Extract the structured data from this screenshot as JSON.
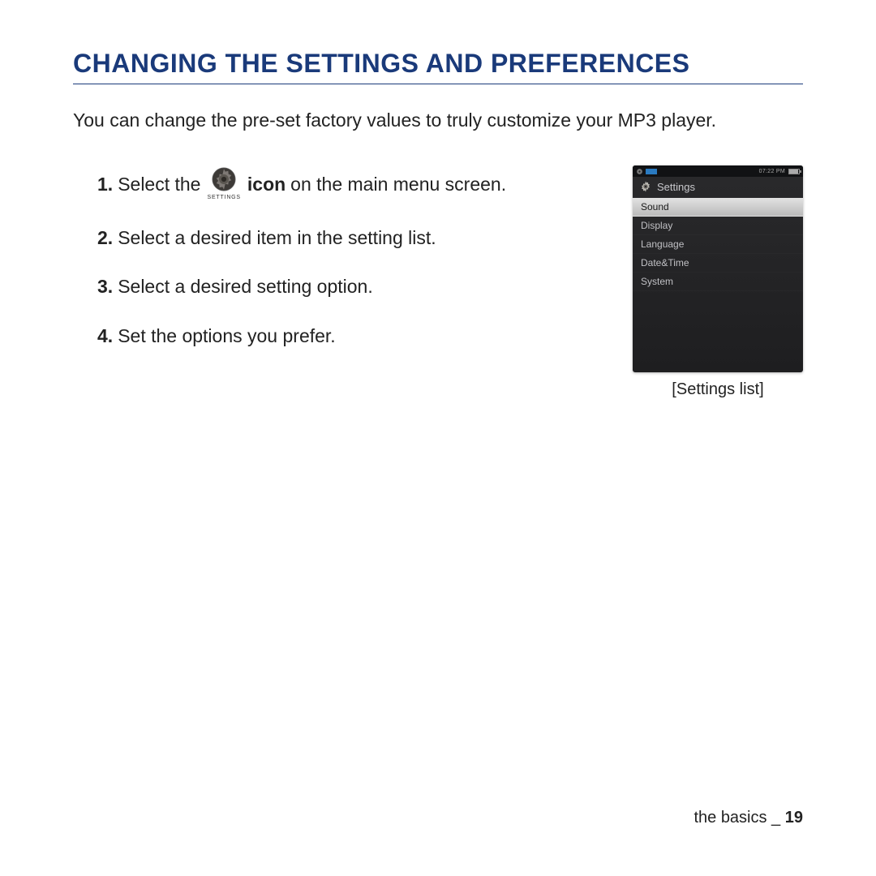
{
  "title": "CHANGING THE SETTINGS AND PREFERENCES",
  "intro": "You can change the pre-set factory values to truly customize your MP3 player.",
  "steps": {
    "s1": {
      "num": "1.",
      "pre": "Select the",
      "bold": "icon",
      "post": "on the main menu screen."
    },
    "s2": {
      "num": "2.",
      "text": "Select a desired item in the setting list."
    },
    "s3": {
      "num": "3.",
      "text": "Select a desired setting option."
    },
    "s4": {
      "num": "4.",
      "text": "Set the options you prefer."
    }
  },
  "settings_icon_label": "SETTINGS",
  "device": {
    "time": "07:22 PM",
    "header": "Settings",
    "items": [
      "Sound",
      "Display",
      "Language",
      "Date&Time",
      "System"
    ],
    "selected_index": 0,
    "caption": "[Settings list]"
  },
  "footer": {
    "section": "the basics _ ",
    "page": "19"
  }
}
